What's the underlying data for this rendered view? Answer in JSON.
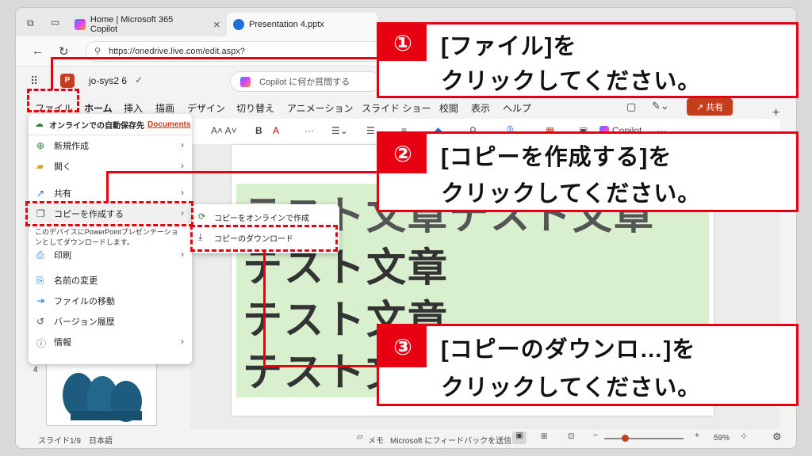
{
  "browser": {
    "tabs": [
      {
        "label": ""
      },
      {
        "label": "Home | Microsoft 365 Copilot"
      },
      {
        "label": "Presentation 4.pptx"
      }
    ],
    "url": "https://onedrive.live.com/edit.aspx?"
  },
  "app": {
    "file_name": "jo-sys2 6",
    "search_placeholder": "Copilot に何か質問する",
    "share_label": "共有"
  },
  "ribbon": {
    "tabs": [
      "ファイル",
      "ホーム",
      "挿入",
      "描画",
      "デザイン",
      "切り替え",
      "アニメーション",
      "スライド ショー",
      "校閲",
      "表示",
      "ヘルプ"
    ],
    "copilot_label": "Copilot"
  },
  "file_menu": {
    "autosave_prefix": "オンラインでの自動保存先",
    "autosave_link": "Documents",
    "items": [
      {
        "label": "新規作成",
        "icon": "plus-circle-icon",
        "has_sub": true
      },
      {
        "label": "開く",
        "icon": "folder-icon",
        "has_sub": true
      },
      {
        "label": "共有",
        "icon": "share-icon",
        "has_sub": true
      },
      {
        "label": "コピーを作成する",
        "icon": "copy-icon",
        "has_sub": true
      },
      {
        "label": "印刷",
        "icon": "print-icon",
        "has_sub": true
      },
      {
        "label": "名前の変更",
        "icon": "rename-icon",
        "has_sub": false
      },
      {
        "label": "ファイルの移動",
        "icon": "move-icon",
        "has_sub": false
      },
      {
        "label": "バージョン履歴",
        "icon": "history-icon",
        "has_sub": false
      },
      {
        "label": "情報",
        "icon": "info-icon",
        "has_sub": true
      }
    ],
    "tooltip": "このデバイスにPowerPointプレゼンテーションとしてダウンロードします。"
  },
  "copy_submenu": {
    "items": [
      {
        "label": "コピーをオンラインで作成"
      },
      {
        "label": "コピーのダウンロード"
      }
    ]
  },
  "slide": {
    "lines": [
      "テスト文章テスト文章",
      "テスト文章",
      "テスト文章",
      "テスト文章"
    ]
  },
  "thumbnail": {
    "number": "4"
  },
  "status": {
    "slide_counter": "スライド1/9",
    "language": "日本語",
    "notes": "メモ",
    "feedback": "Microsoft にフィードバックを送信",
    "zoom": "59%"
  },
  "callouts": [
    {
      "number": "①",
      "line1": "[ファイル]を",
      "line2": "クリックしてください。"
    },
    {
      "number": "②",
      "line1": "[コピーを作成する]を",
      "line2": "クリックしてください。"
    },
    {
      "number": "③",
      "line1": "[コピーのダウンロ…]を",
      "line2": "クリックしてください。"
    }
  ],
  "colors": {
    "accent": "#e60012",
    "highlight": "#d9f0cf"
  }
}
